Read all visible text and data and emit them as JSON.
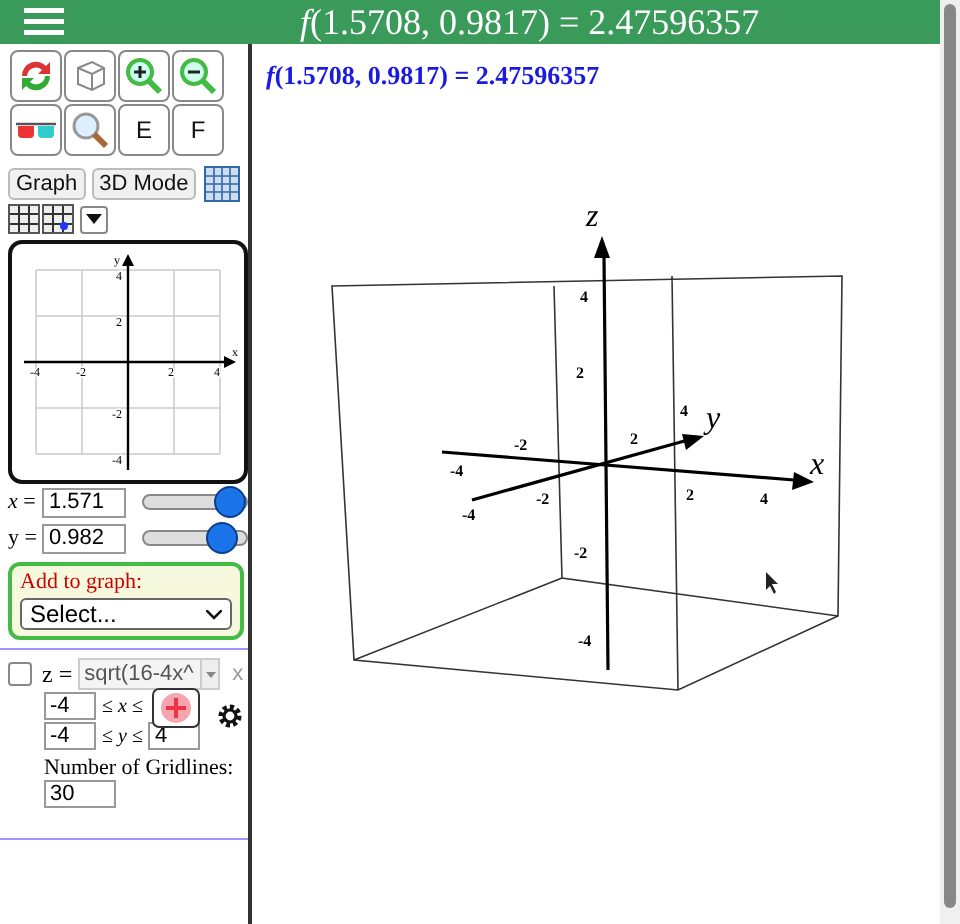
{
  "header": {
    "title": "*f*(1.5708, 0.9817) = 2.47596357"
  },
  "tool_buttons": [
    {
      "label": "E"
    },
    {
      "label": "F"
    }
  ],
  "mode_buttons": [
    {
      "label": "Graph"
    },
    {
      "label": "3D Mode"
    }
  ],
  "mini_graph": {
    "x_label": "x",
    "y_label": "y",
    "x_ticks": [
      "-4",
      "-2",
      "2",
      "4"
    ],
    "y_ticks": [
      "4",
      "2",
      "-2",
      "-4"
    ]
  },
  "sliders": [
    {
      "label": "*x* =",
      "value": "1.571",
      "level": 0.82
    },
    {
      "label": "y =",
      "value": "0.982",
      "level": 0.74
    }
  ],
  "add_to_graph": {
    "title": "Add to graph:",
    "select": "Select..."
  },
  "function": {
    "checked": false,
    "label": "z =",
    "expression": "sqrt(16-4x^",
    "close": "x",
    "x_min": "-4",
    "x_rel": "≤ *x* ≤",
    "y_min": "-4",
    "y_rel": "≤ *y* ≤",
    "y_max": "4",
    "gridlines_label": "Number of Gridlines:",
    "gridlines": "30"
  },
  "result": "*f*(1.5708, 0.9817) = 2.47596357",
  "plot3d": {
    "x_label": "x",
    "y_label": "y",
    "z_label": "z",
    "z_ticks": [
      "4",
      "2",
      "-2",
      "-4"
    ],
    "x_ticks": [
      "-4",
      "-2",
      "2",
      "4"
    ],
    "y_ticks": [
      "-4",
      "-2",
      "2",
      "4"
    ]
  }
}
